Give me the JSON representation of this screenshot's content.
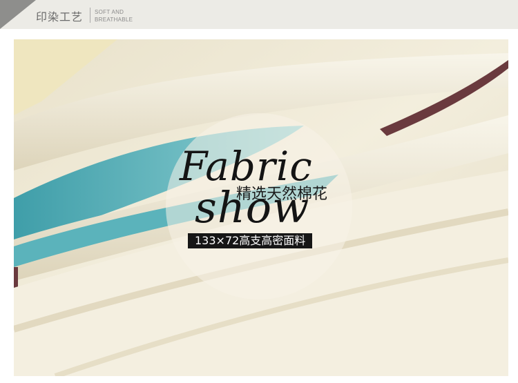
{
  "header": {
    "title": "印染工艺",
    "subtitle_line1": "SOFT AND",
    "subtitle_line2": "BREATHABLE"
  },
  "badge": {
    "word_top": "Fabric",
    "word_bottom": "show",
    "tagline": "精选天然棉花",
    "spec": "133×72高支高密面料"
  },
  "colors": {
    "header_bg": "#ecebe6",
    "header_tab": "#8e8e8c",
    "fabric_cream": "#f1ecd9",
    "fabric_teal": "#5bb3bb",
    "fabric_plum": "#6a3a3e",
    "text_dark": "#141414"
  }
}
